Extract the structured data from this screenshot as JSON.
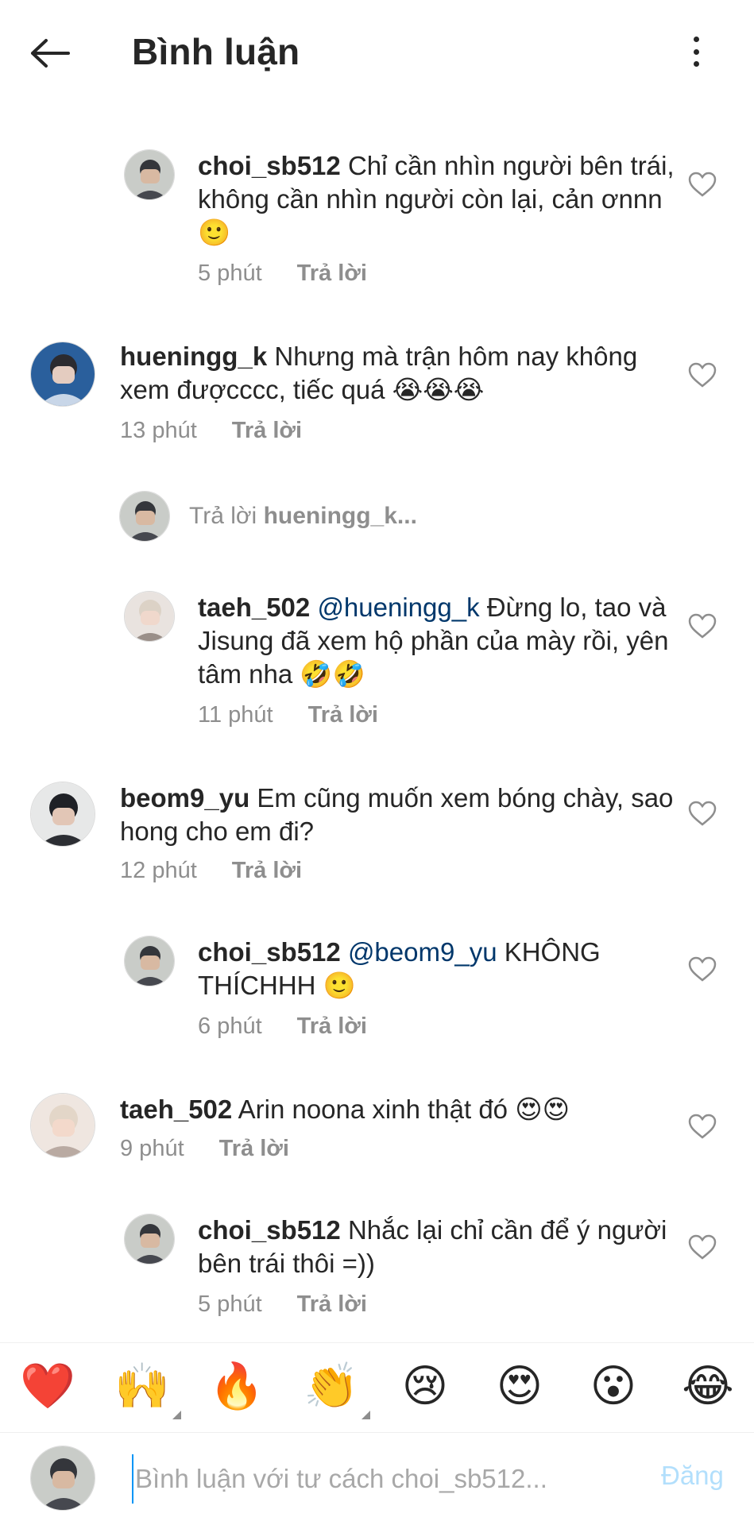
{
  "header": {
    "title": "Bình luận",
    "back_icon": "arrow-left-icon",
    "more_icon": "more-vertical-icon"
  },
  "comments": [
    {
      "username": "choi_sb512",
      "text": "Chỉ cần nhìn người bên trái, không cần nhìn người còn lại, cản ơnnn 🙂",
      "time": "5 phút",
      "reply": "Trả lời",
      "avatar": "choi"
    },
    {
      "username": "hueningg_k",
      "text": "Nhưng mà trận hôm nay không xem đượcccc, tiếc quá 😭😭😭",
      "time": "13 phút",
      "reply": "Trả lời",
      "avatar": "hueningg"
    },
    {
      "username": "taeh_502",
      "mention": "@hueningg_k",
      "text": " Đừng lo, tao và Jisung đã xem hộ phần của mày rồi, yên tâm nha 🤣🤣",
      "time": "11 phút",
      "reply": "Trả lời",
      "avatar": "taeh"
    },
    {
      "username": "beom9_yu",
      "text": "Em cũng muốn xem bóng chày, sao hong cho em đi?",
      "time": "12 phút",
      "reply": "Trả lời",
      "avatar": "beom"
    },
    {
      "username": "choi_sb512",
      "mention": "@beom9_yu",
      "text": " KHÔNG THÍCHHH 🙂",
      "time": "6 phút",
      "reply": "Trả lời",
      "avatar": "choi"
    },
    {
      "username": "taeh_502",
      "text": "Arin noona xinh thật đó 😍😍",
      "time": "9 phút",
      "reply": "Trả lời",
      "avatar": "taeh"
    },
    {
      "username": "choi_sb512",
      "text": "Nhắc lại chỉ cần để ý người bên trái thôi =))",
      "time": "5 phút",
      "reply": "Trả lời",
      "avatar": "choi"
    }
  ],
  "reply_indicator": {
    "prefix": "Trả lời",
    "username": "hueningg_k..."
  },
  "emoji_bar": [
    "❤️",
    "🙌",
    "🔥",
    "👏",
    "😢",
    "😍",
    "😮",
    "😂"
  ],
  "input": {
    "placeholder": "Bình luận với tư cách choi_sb512...",
    "post_label": "Đăng"
  },
  "colors": {
    "mention": "#00376b",
    "meta": "#8e8e8e",
    "post_disabled": "#b2dffc",
    "accent": "#0095f6"
  }
}
